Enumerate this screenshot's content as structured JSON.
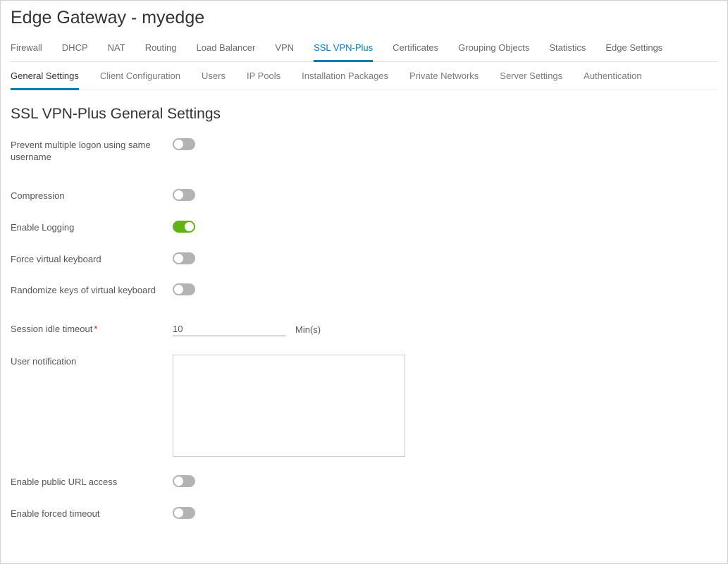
{
  "pageTitle": "Edge Gateway - myedge",
  "primaryTabs": [
    {
      "label": "Firewall",
      "active": false
    },
    {
      "label": "DHCP",
      "active": false
    },
    {
      "label": "NAT",
      "active": false
    },
    {
      "label": "Routing",
      "active": false
    },
    {
      "label": "Load Balancer",
      "active": false
    },
    {
      "label": "VPN",
      "active": false
    },
    {
      "label": "SSL VPN-Plus",
      "active": true
    },
    {
      "label": "Certificates",
      "active": false
    },
    {
      "label": "Grouping Objects",
      "active": false
    },
    {
      "label": "Statistics",
      "active": false
    },
    {
      "label": "Edge Settings",
      "active": false
    }
  ],
  "secondaryTabs": [
    {
      "label": "General Settings",
      "active": true
    },
    {
      "label": "Client Configuration",
      "active": false
    },
    {
      "label": "Users",
      "active": false
    },
    {
      "label": "IP Pools",
      "active": false
    },
    {
      "label": "Installation Packages",
      "active": false
    },
    {
      "label": "Private Networks",
      "active": false
    },
    {
      "label": "Server Settings",
      "active": false
    },
    {
      "label": "Authentication",
      "active": false
    }
  ],
  "sectionTitle": "SSL VPN-Plus General Settings",
  "form": {
    "preventMultiLogon": {
      "label": "Prevent multiple logon using same username",
      "value": false
    },
    "compression": {
      "label": "Compression",
      "value": false
    },
    "enableLogging": {
      "label": "Enable Logging",
      "value": true
    },
    "forceVirtualKeyboard": {
      "label": "Force virtual keyboard",
      "value": false
    },
    "randomizeKeys": {
      "label": "Randomize keys of virtual keyboard",
      "value": false
    },
    "sessionIdleTimeout": {
      "label": "Session idle timeout",
      "value": "10",
      "unit": "Min(s)",
      "required": true
    },
    "userNotification": {
      "label": "User notification",
      "value": ""
    },
    "enablePublicUrl": {
      "label": "Enable public URL access",
      "value": false
    },
    "enableForcedTimeout": {
      "label": "Enable forced timeout",
      "value": false
    }
  }
}
